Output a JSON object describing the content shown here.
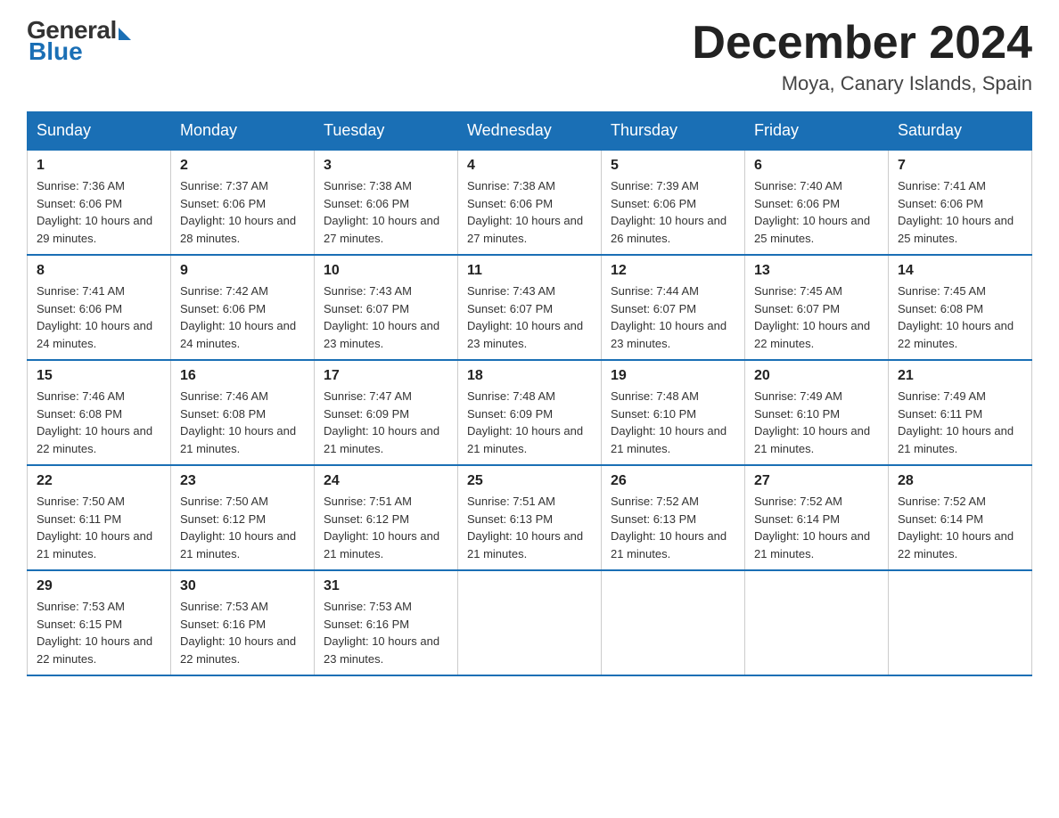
{
  "header": {
    "logo_general": "General",
    "logo_blue": "Blue",
    "month_title": "December 2024",
    "location": "Moya, Canary Islands, Spain"
  },
  "days_of_week": [
    "Sunday",
    "Monday",
    "Tuesday",
    "Wednesday",
    "Thursday",
    "Friday",
    "Saturday"
  ],
  "weeks": [
    [
      {
        "day": "1",
        "sunrise": "7:36 AM",
        "sunset": "6:06 PM",
        "daylight": "10 hours and 29 minutes."
      },
      {
        "day": "2",
        "sunrise": "7:37 AM",
        "sunset": "6:06 PM",
        "daylight": "10 hours and 28 minutes."
      },
      {
        "day": "3",
        "sunrise": "7:38 AM",
        "sunset": "6:06 PM",
        "daylight": "10 hours and 27 minutes."
      },
      {
        "day": "4",
        "sunrise": "7:38 AM",
        "sunset": "6:06 PM",
        "daylight": "10 hours and 27 minutes."
      },
      {
        "day": "5",
        "sunrise": "7:39 AM",
        "sunset": "6:06 PM",
        "daylight": "10 hours and 26 minutes."
      },
      {
        "day": "6",
        "sunrise": "7:40 AM",
        "sunset": "6:06 PM",
        "daylight": "10 hours and 25 minutes."
      },
      {
        "day": "7",
        "sunrise": "7:41 AM",
        "sunset": "6:06 PM",
        "daylight": "10 hours and 25 minutes."
      }
    ],
    [
      {
        "day": "8",
        "sunrise": "7:41 AM",
        "sunset": "6:06 PM",
        "daylight": "10 hours and 24 minutes."
      },
      {
        "day": "9",
        "sunrise": "7:42 AM",
        "sunset": "6:06 PM",
        "daylight": "10 hours and 24 minutes."
      },
      {
        "day": "10",
        "sunrise": "7:43 AM",
        "sunset": "6:07 PM",
        "daylight": "10 hours and 23 minutes."
      },
      {
        "day": "11",
        "sunrise": "7:43 AM",
        "sunset": "6:07 PM",
        "daylight": "10 hours and 23 minutes."
      },
      {
        "day": "12",
        "sunrise": "7:44 AM",
        "sunset": "6:07 PM",
        "daylight": "10 hours and 23 minutes."
      },
      {
        "day": "13",
        "sunrise": "7:45 AM",
        "sunset": "6:07 PM",
        "daylight": "10 hours and 22 minutes."
      },
      {
        "day": "14",
        "sunrise": "7:45 AM",
        "sunset": "6:08 PM",
        "daylight": "10 hours and 22 minutes."
      }
    ],
    [
      {
        "day": "15",
        "sunrise": "7:46 AM",
        "sunset": "6:08 PM",
        "daylight": "10 hours and 22 minutes."
      },
      {
        "day": "16",
        "sunrise": "7:46 AM",
        "sunset": "6:08 PM",
        "daylight": "10 hours and 21 minutes."
      },
      {
        "day": "17",
        "sunrise": "7:47 AM",
        "sunset": "6:09 PM",
        "daylight": "10 hours and 21 minutes."
      },
      {
        "day": "18",
        "sunrise": "7:48 AM",
        "sunset": "6:09 PM",
        "daylight": "10 hours and 21 minutes."
      },
      {
        "day": "19",
        "sunrise": "7:48 AM",
        "sunset": "6:10 PM",
        "daylight": "10 hours and 21 minutes."
      },
      {
        "day": "20",
        "sunrise": "7:49 AM",
        "sunset": "6:10 PM",
        "daylight": "10 hours and 21 minutes."
      },
      {
        "day": "21",
        "sunrise": "7:49 AM",
        "sunset": "6:11 PM",
        "daylight": "10 hours and 21 minutes."
      }
    ],
    [
      {
        "day": "22",
        "sunrise": "7:50 AM",
        "sunset": "6:11 PM",
        "daylight": "10 hours and 21 minutes."
      },
      {
        "day": "23",
        "sunrise": "7:50 AM",
        "sunset": "6:12 PM",
        "daylight": "10 hours and 21 minutes."
      },
      {
        "day": "24",
        "sunrise": "7:51 AM",
        "sunset": "6:12 PM",
        "daylight": "10 hours and 21 minutes."
      },
      {
        "day": "25",
        "sunrise": "7:51 AM",
        "sunset": "6:13 PM",
        "daylight": "10 hours and 21 minutes."
      },
      {
        "day": "26",
        "sunrise": "7:52 AM",
        "sunset": "6:13 PM",
        "daylight": "10 hours and 21 minutes."
      },
      {
        "day": "27",
        "sunrise": "7:52 AM",
        "sunset": "6:14 PM",
        "daylight": "10 hours and 21 minutes."
      },
      {
        "day": "28",
        "sunrise": "7:52 AM",
        "sunset": "6:14 PM",
        "daylight": "10 hours and 22 minutes."
      }
    ],
    [
      {
        "day": "29",
        "sunrise": "7:53 AM",
        "sunset": "6:15 PM",
        "daylight": "10 hours and 22 minutes."
      },
      {
        "day": "30",
        "sunrise": "7:53 AM",
        "sunset": "6:16 PM",
        "daylight": "10 hours and 22 minutes."
      },
      {
        "day": "31",
        "sunrise": "7:53 AM",
        "sunset": "6:16 PM",
        "daylight": "10 hours and 23 minutes."
      },
      null,
      null,
      null,
      null
    ]
  ],
  "labels": {
    "sunrise_prefix": "Sunrise: ",
    "sunset_prefix": "Sunset: ",
    "daylight_prefix": "Daylight: "
  }
}
